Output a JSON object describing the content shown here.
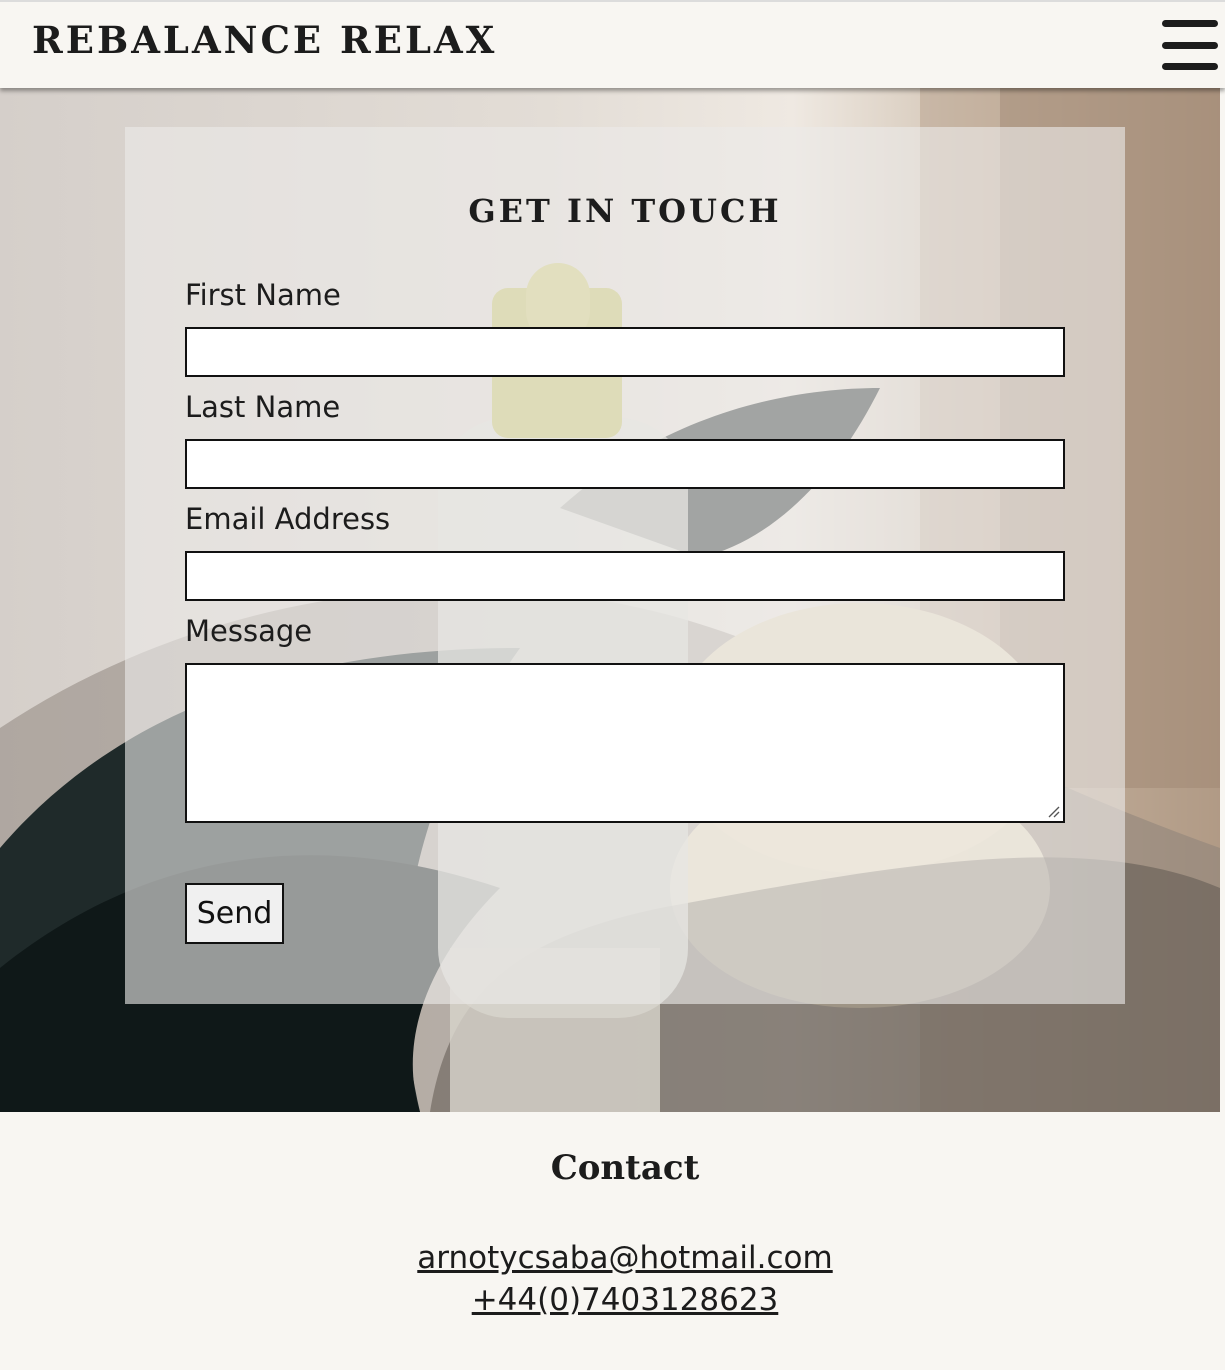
{
  "header": {
    "brand": "REBALANCE RELAX"
  },
  "form": {
    "title": "GET IN TOUCH",
    "first_name_label": "First Name",
    "last_name_label": "Last Name",
    "email_label": "Email Address",
    "message_label": "Message",
    "first_name_value": "",
    "last_name_value": "",
    "email_value": "",
    "message_value": "",
    "send_label": "Send"
  },
  "footer": {
    "title": "Contact",
    "email": "arnotycsaba@hotmail.com",
    "phone": "+44(0)7403128623"
  },
  "icons": {
    "menu": "hamburger-menu-icon",
    "resize": "resize-grip-icon"
  },
  "colors": {
    "background": "#f8f6f2",
    "text": "#1c1c1c"
  }
}
